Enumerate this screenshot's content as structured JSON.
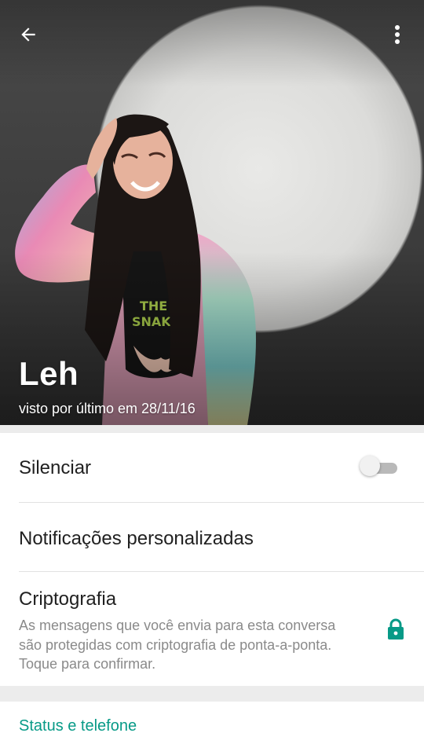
{
  "header": {
    "contact_name": "Leh",
    "last_seen": "visto por último em 28/11/16",
    "back_icon": "arrow-left-icon",
    "menu_icon": "more-vert-icon"
  },
  "settings": {
    "mute_label": "Silenciar",
    "mute_enabled": false,
    "notifications_label": "Notificações personalizadas",
    "encryption_label": "Criptografia",
    "encryption_description": "As mensagens que você envia para esta conversa são protegidas com criptografia de ponta-a-ponta. Toque para confirmar.",
    "encryption_icon": "lock-icon"
  },
  "status_section": {
    "title": "Status e telefone"
  },
  "colors": {
    "accent": "#079a87",
    "toggle_track": "#b9b9b9",
    "toggle_thumb": "#f1f1f1"
  }
}
